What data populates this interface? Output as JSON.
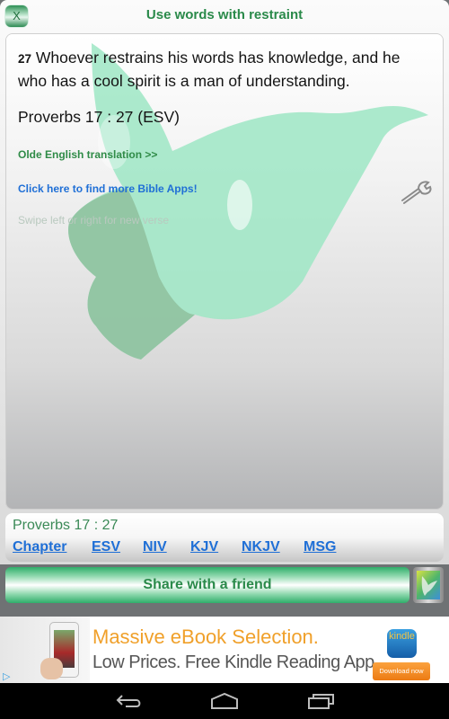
{
  "titlebar": {
    "close_label": "X",
    "title": "Use words with restraint"
  },
  "verse": {
    "number": "27",
    "text": " Whoever restrains his words has knowledge, and he who has a cool spirit is a man of understanding.",
    "reference": "Proverbs 17 : 27  (ESV)",
    "olde_english_link": "Olde English translation >>",
    "more_apps_link": "Click here to find more Bible Apps!",
    "swipe_hint": "Swipe left or right for new verse"
  },
  "reference_panel": {
    "label": "Proverbs 17 : 27",
    "links": [
      "Chapter",
      "ESV",
      "NIV",
      "KJV",
      "NKJV",
      "MSG"
    ]
  },
  "share": {
    "button_label": "Share with a friend"
  },
  "ad": {
    "headline": "Massive eBook Selection.",
    "subline": "Low Prices. Free Kindle Reading App.",
    "app_icon_label": "kindle",
    "cta_label": "Download now",
    "adchoices_icon": "▷"
  },
  "colors": {
    "accent_green": "#2a8a4a",
    "link_blue": "#1f6fd6",
    "ad_orange": "#f0a02a"
  }
}
